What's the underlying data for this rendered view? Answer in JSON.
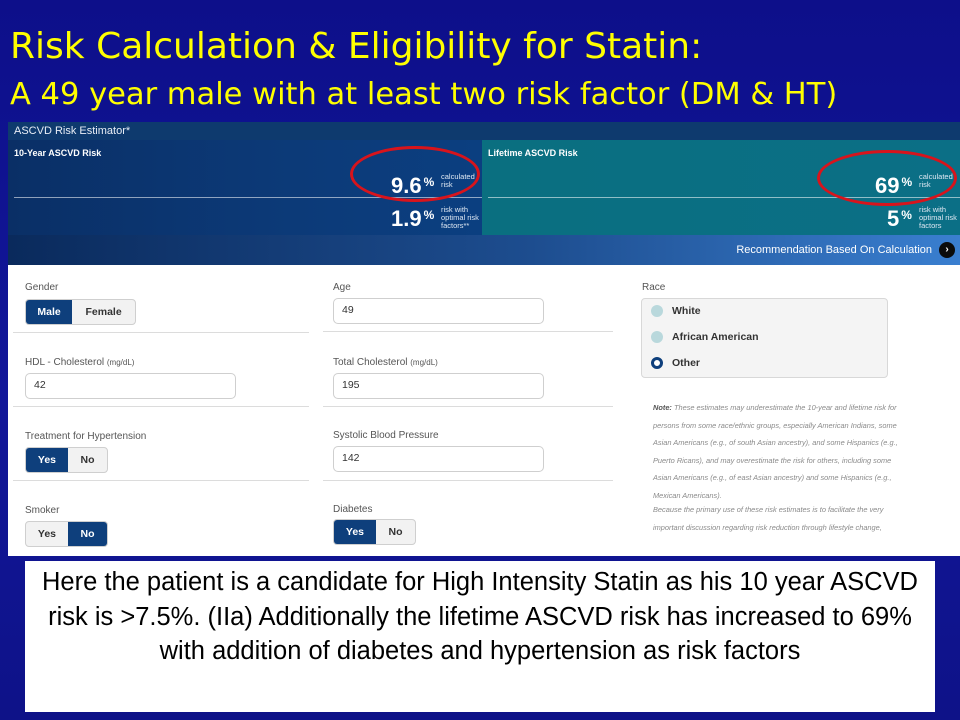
{
  "slide": {
    "title_line1": "Risk Calculation & Eligibility for Statin:",
    "title_line2": "A 49 year male with at least two risk factor (DM & HT)",
    "caption": "Here the patient is a candidate for High Intensity Statin as his 10 year ASCVD risk is >7.5%. (IIa) Additionally the lifetime ASCVD risk has increased to 69% with addition of diabetes and hypertension as risk factors",
    "colors": {
      "background": "#10148f",
      "title": "#ffff00",
      "highlight_circle": "#d8141c"
    }
  },
  "estimator": {
    "header_title": "ASCVD Risk Estimator*",
    "ten_year": {
      "label": "10-Year ASCVD Risk",
      "calculated_value": "9.6",
      "calculated_caption": "calculated\nrisk",
      "optimal_value": "1.9",
      "optimal_caption": "risk with\noptimal risk\nfactors**"
    },
    "lifetime": {
      "label": "Lifetime ASCVD Risk",
      "calculated_value": "69",
      "calculated_caption": "calculated\nrisk",
      "optimal_value": "5",
      "optimal_caption": "risk with\noptimal risk\nfactors"
    },
    "percent_sign": "%",
    "recommendation_link": "Recommendation Based On Calculation",
    "recommendation_icon": "chevron-right-icon"
  },
  "form": {
    "gender": {
      "label": "Gender",
      "options": [
        "Male",
        "Female"
      ],
      "selected": "Male"
    },
    "age": {
      "label": "Age",
      "value": "49"
    },
    "race": {
      "label": "Race",
      "options": [
        "White",
        "African American",
        "Other"
      ],
      "selected": "Other"
    },
    "hdl": {
      "label": "HDL - Cholesterol",
      "unit": "(mg/dL)",
      "value": "42"
    },
    "total_cholesterol": {
      "label": "Total Cholesterol",
      "unit": "(mg/dL)",
      "value": "195"
    },
    "treatment_htn": {
      "label": "Treatment for Hypertension",
      "options": [
        "Yes",
        "No"
      ],
      "selected": "Yes"
    },
    "systolic_bp": {
      "label": "Systolic Blood Pressure",
      "value": "142"
    },
    "smoker": {
      "label": "Smoker",
      "options": [
        "Yes",
        "No"
      ],
      "selected": "No"
    },
    "diabetes": {
      "label": "Diabetes",
      "options": [
        "Yes",
        "No"
      ],
      "selected": "Yes"
    }
  },
  "note": {
    "heading": "Note:",
    "text1": "These estimates may underestimate the 10-year and lifetime risk for persons from some race/ethnic groups, especially American Indians, some Asian Americans (e.g., of south Asian ancestry), and some Hispanics (e.g., Puerto Ricans), and may overestimate the risk for others, including some Asian Americans (e.g., of east Asian ancestry) and some Hispanics (e.g., Mexican Americans).",
    "text2": "Because the primary use of these risk estimates is to facilitate the very important discussion regarding risk reduction through lifestyle change,"
  }
}
